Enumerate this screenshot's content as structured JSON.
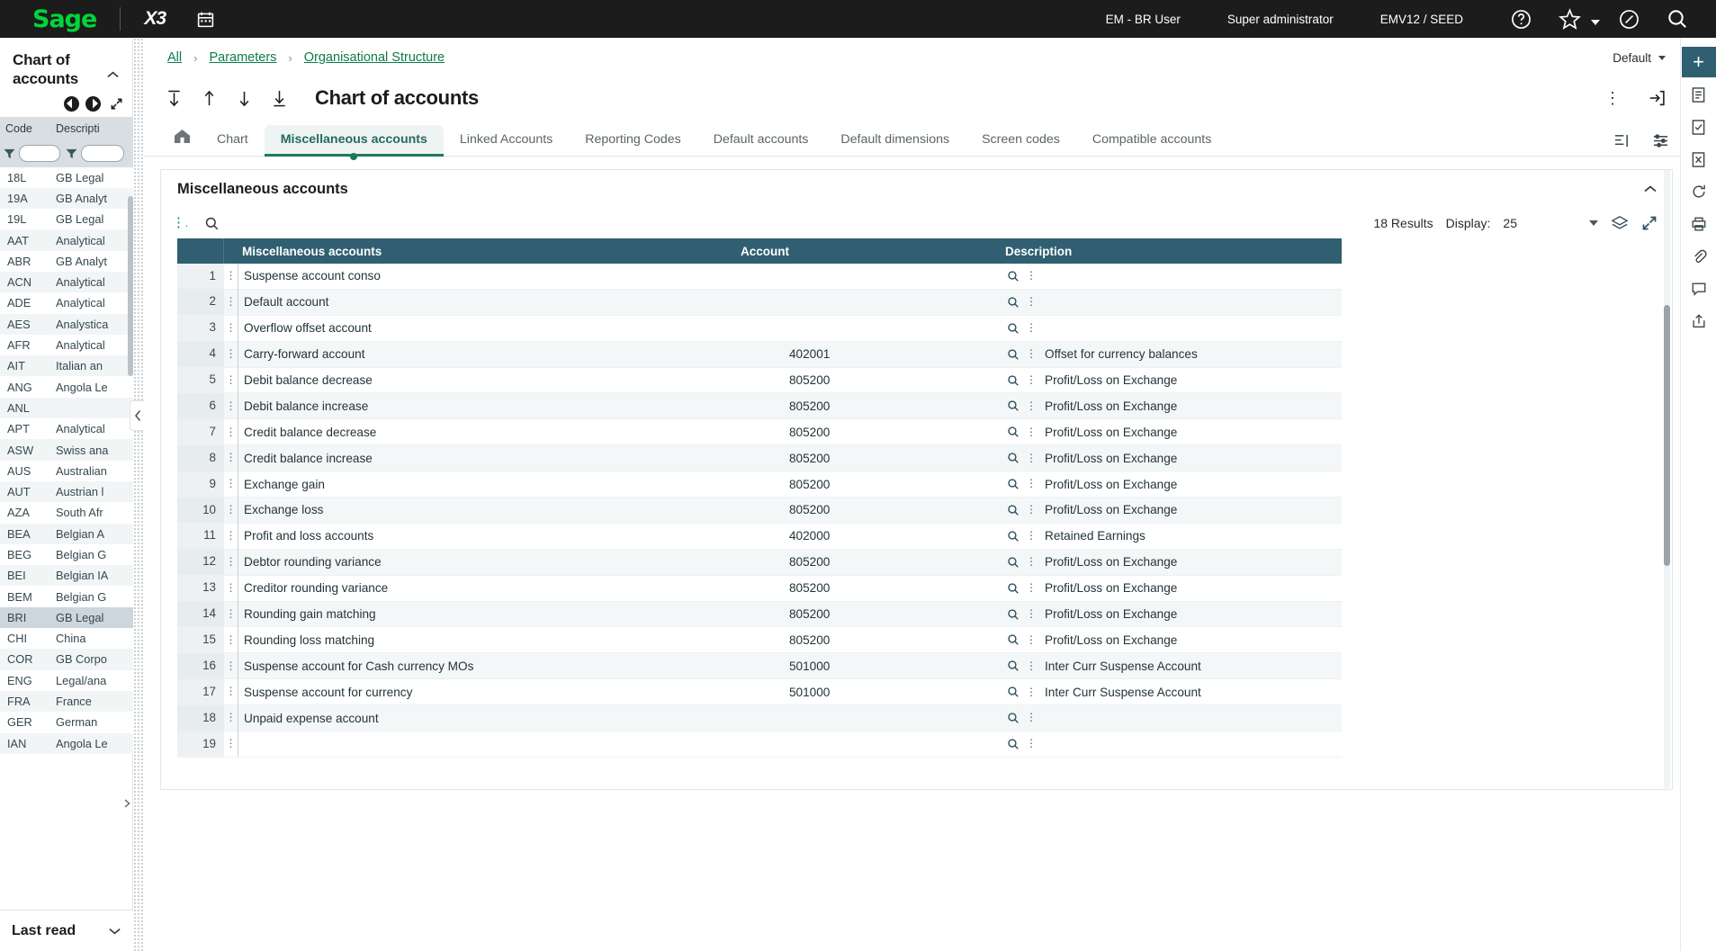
{
  "topbar": {
    "brand": "Sage",
    "product": "X3",
    "calendar_icon": "calendar-icon",
    "user": "EM - BR User",
    "role": "Super administrator",
    "environment": "EMV12 / SEED",
    "help_icon": "help-icon",
    "favorites_icon": "star-icon",
    "compass_icon": "compass-icon",
    "search_icon": "search-icon"
  },
  "left_panel": {
    "title": "Chart of accounts",
    "collapse_icon": "chevron-up-icon",
    "prev_icon": "previous-record-icon",
    "next_icon": "next-record-icon",
    "expand_icon": "expand-icon",
    "columns": [
      "Code",
      "Descripti"
    ],
    "filter_placeholder": "",
    "filter_value_code": "",
    "filter_value_desc": "",
    "rows": [
      {
        "code": "18L",
        "desc": "GB Legal",
        "selected": false
      },
      {
        "code": "19A",
        "desc": "GB Analyt",
        "selected": false
      },
      {
        "code": "19L",
        "desc": "GB Legal",
        "selected": false
      },
      {
        "code": "AAT",
        "desc": "Analytical",
        "selected": false
      },
      {
        "code": "ABR",
        "desc": "GB Analyt",
        "selected": false
      },
      {
        "code": "ACN",
        "desc": "Analytical",
        "selected": false
      },
      {
        "code": "ADE",
        "desc": "Analytical",
        "selected": false
      },
      {
        "code": "AES",
        "desc": "Analystica",
        "selected": false
      },
      {
        "code": "AFR",
        "desc": "Analytical",
        "selected": false
      },
      {
        "code": "AIT",
        "desc": "Italian an",
        "selected": false
      },
      {
        "code": "ANG",
        "desc": "Angola Le",
        "selected": false
      },
      {
        "code": "ANL",
        "desc": "",
        "selected": false
      },
      {
        "code": "APT",
        "desc": "Analytical",
        "selected": false
      },
      {
        "code": "ASW",
        "desc": "Swiss ana",
        "selected": false
      },
      {
        "code": "AUS",
        "desc": "Australian",
        "selected": false
      },
      {
        "code": "AUT",
        "desc": "Austrian l",
        "selected": false
      },
      {
        "code": "AZA",
        "desc": "South Afr",
        "selected": false
      },
      {
        "code": "BEA",
        "desc": "Belgian A",
        "selected": false
      },
      {
        "code": "BEG",
        "desc": "Belgian G",
        "selected": false
      },
      {
        "code": "BEI",
        "desc": "Belgian IA",
        "selected": false
      },
      {
        "code": "BEM",
        "desc": "Belgian G",
        "selected": false
      },
      {
        "code": "BRI",
        "desc": "GB Legal",
        "selected": true
      },
      {
        "code": "CHI",
        "desc": "China",
        "selected": false
      },
      {
        "code": "COR",
        "desc": "GB Corpo",
        "selected": false
      },
      {
        "code": "ENG",
        "desc": "Legal/ana",
        "selected": false
      },
      {
        "code": "FRA",
        "desc": "France",
        "selected": false
      },
      {
        "code": "GER",
        "desc": "German",
        "selected": false
      },
      {
        "code": "IAN",
        "desc": "Angola Le",
        "selected": false
      }
    ],
    "bottom_section_title": "Last read",
    "bottom_chevron": "chevron-down-icon"
  },
  "breadcrumb": {
    "items": [
      "All",
      "Parameters",
      "Organisational Structure"
    ],
    "separator": "›",
    "view_label": "Default",
    "view_caret": "chevron-down-icon"
  },
  "page_header": {
    "title": "Chart of accounts",
    "first_icon": "go-to-first-icon",
    "prev_icon": "go-to-previous-icon",
    "next_icon": "go-to-next-icon",
    "last_icon": "go-to-last-icon",
    "more_icon": "kebab-menu-icon",
    "exit_icon": "exit-icon"
  },
  "tabs": {
    "home_icon": "home-icon",
    "items": [
      {
        "label": "Chart",
        "active": false
      },
      {
        "label": "Miscellaneous accounts",
        "active": true
      },
      {
        "label": "Linked Accounts",
        "active": false
      },
      {
        "label": "Reporting Codes",
        "active": false
      },
      {
        "label": "Default accounts",
        "active": false
      },
      {
        "label": "Default dimensions",
        "active": false
      },
      {
        "label": "Screen codes",
        "active": false
      },
      {
        "label": "Compatible accounts",
        "active": false
      }
    ],
    "right_icons": [
      "list-view-icon",
      "settings-list-icon"
    ]
  },
  "card": {
    "title": "Miscellaneous accounts",
    "collapse_icon": "chevron-up-icon"
  },
  "grid_toolbar": {
    "menu_icon": "kebab-menu-icon",
    "search_icon": "search-icon",
    "results_label": "18 Results",
    "display_label": "Display:",
    "display_value": "25",
    "display_caret": "chevron-down-icon",
    "layers_icon": "layers-icon",
    "expand_icon": "expand-icon"
  },
  "table": {
    "columns": [
      "",
      "Miscellaneous accounts",
      "Account",
      "Description"
    ],
    "rows": [
      {
        "n": "1",
        "name": "Suspense account conso",
        "account": "",
        "description": ""
      },
      {
        "n": "2",
        "name": "Default account",
        "account": "",
        "description": ""
      },
      {
        "n": "3",
        "name": "Overflow offset account",
        "account": "",
        "description": ""
      },
      {
        "n": "4",
        "name": "Carry-forward account",
        "account": "402001",
        "description": "Offset for currency balances"
      },
      {
        "n": "5",
        "name": "Debit balance decrease",
        "account": "805200",
        "description": "Profit/Loss on Exchange"
      },
      {
        "n": "6",
        "name": "Debit balance increase",
        "account": "805200",
        "description": "Profit/Loss on Exchange"
      },
      {
        "n": "7",
        "name": "Credit balance decrease",
        "account": "805200",
        "description": "Profit/Loss on Exchange"
      },
      {
        "n": "8",
        "name": "Credit balance increase",
        "account": "805200",
        "description": "Profit/Loss on Exchange"
      },
      {
        "n": "9",
        "name": "Exchange gain",
        "account": "805200",
        "description": "Profit/Loss on Exchange"
      },
      {
        "n": "10",
        "name": "Exchange loss",
        "account": "805200",
        "description": "Profit/Loss on Exchange"
      },
      {
        "n": "11",
        "name": "Profit and loss accounts",
        "account": "402000",
        "description": "Retained Earnings"
      },
      {
        "n": "12",
        "name": "Debtor rounding variance",
        "account": "805200",
        "description": "Profit/Loss on Exchange"
      },
      {
        "n": "13",
        "name": "Creditor rounding variance",
        "account": "805200",
        "description": "Profit/Loss on Exchange"
      },
      {
        "n": "14",
        "name": "Rounding gain matching",
        "account": "805200",
        "description": "Profit/Loss on Exchange"
      },
      {
        "n": "15",
        "name": "Rounding loss matching",
        "account": "805200",
        "description": "Profit/Loss on Exchange"
      },
      {
        "n": "16",
        "name": "Suspense account for Cash currency MOs",
        "account": "501000",
        "description": "Inter Curr Suspense Account"
      },
      {
        "n": "17",
        "name": "Suspense account for currency",
        "account": "501000",
        "description": "Inter Curr Suspense Account"
      },
      {
        "n": "18",
        "name": "Unpaid expense account",
        "account": "",
        "description": ""
      },
      {
        "n": "19",
        "name": "",
        "account": "",
        "description": ""
      }
    ],
    "row_lookup_icon": "magnifier-icon",
    "row_menu_icon": "kebab-menu-icon",
    "row_grip_icon": "drag-handle-icon"
  },
  "right_rail": {
    "add_icon": "add-icon",
    "icons": [
      "document-icon",
      "checklist-icon",
      "close-box-icon",
      "refresh-icon",
      "print-icon",
      "attachment-icon",
      "comment-icon",
      "share-icon"
    ]
  },
  "colors": {
    "topbar_bg": "#1c1c1c",
    "brand_green": "#00d639",
    "table_header": "#2f5f70",
    "link_green": "#0d7a4a",
    "active_tab": "#1f7a5a"
  }
}
